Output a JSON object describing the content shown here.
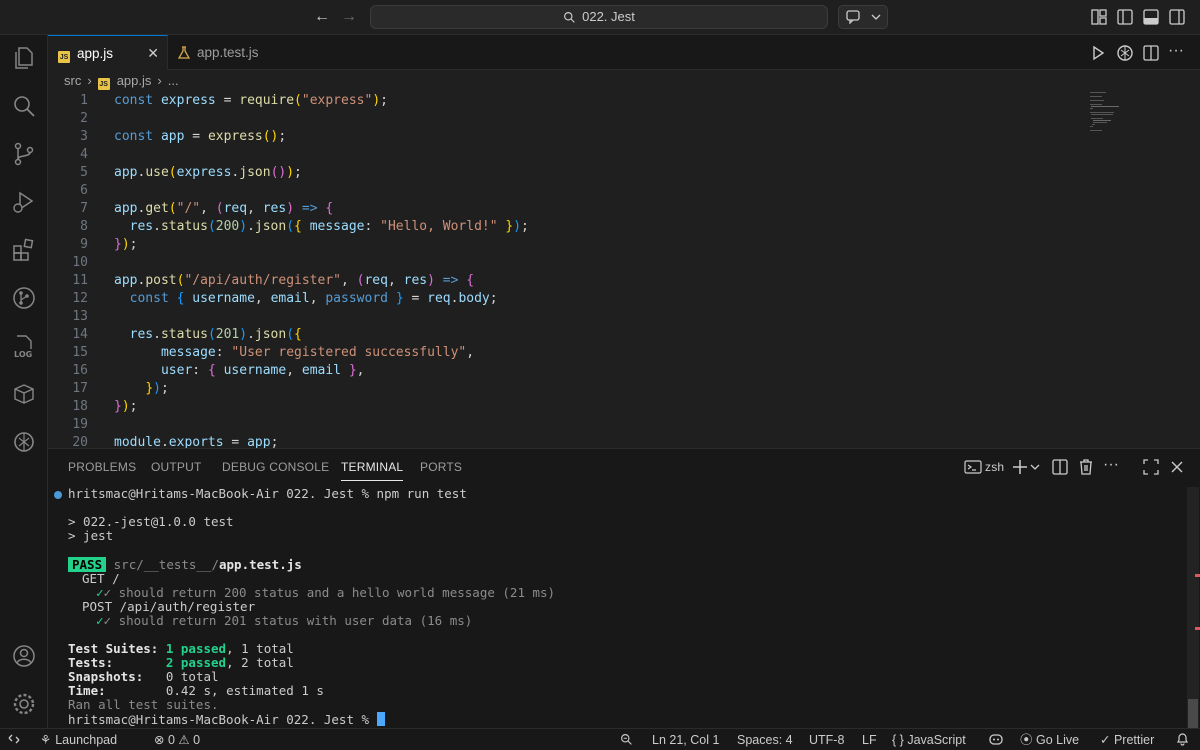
{
  "titlebar": {
    "back_icon": "arrow-left-icon",
    "forward_icon": "arrow-right-icon",
    "search_text": "022. Jest"
  },
  "tabs": [
    {
      "label": "app.js",
      "icon": "js-file-icon",
      "active": true
    },
    {
      "label": "app.test.js",
      "icon": "flask-icon",
      "active": false
    }
  ],
  "tabs_badge": "JS",
  "breadcrumb": {
    "folder": "src",
    "file": "app.js",
    "more": "..."
  },
  "editor": {
    "line_numbers": [
      "1",
      "2",
      "3",
      "4",
      "5",
      "6",
      "7",
      "8",
      "9",
      "10",
      "11",
      "12",
      "13",
      "14",
      "15",
      "16",
      "17",
      "18",
      "19",
      "20"
    ]
  },
  "panel": {
    "tabs": [
      "PROBLEMS",
      "OUTPUT",
      "DEBUG CONSOLE",
      "TERMINAL",
      "PORTS"
    ],
    "active_tab": "TERMINAL",
    "shell": "zsh"
  },
  "terminal": {
    "prompt": "hritsmac@Hritams-MacBook-Air 022. Jest % npm run test",
    "script_line": "> 022.-jest@1.0.0 test",
    "jest_line": "> jest",
    "pass_badge": "PASS",
    "suite_path": "src/__tests__/",
    "suite_file": "app.test.js",
    "group1": "GET /",
    "test1": "✓ should return 200 status and a hello world message (21 ms)",
    "group2": "POST /api/auth/register",
    "test2": "✓ should return 201 status with user data (16 ms)",
    "suites_label": "Test Suites:",
    "suites_passed": "1 passed",
    "suites_total": ", 1 total",
    "tests_label": "Tests:",
    "tests_passed": "2 passed",
    "tests_total": ", 2 total",
    "snapshots_label": "Snapshots:",
    "snapshots_value": "0 total",
    "time_label": "Time:",
    "time_value": "0.42 s, estimated 1 s",
    "ran_all": "Ran all test suites.",
    "final_prompt": "hritsmac@Hritams-MacBook-Air 022. Jest % "
  },
  "statusbar": {
    "launchpad": "Launchpad",
    "errors": "0",
    "warnings": "0",
    "position": "Ln 21, Col 1",
    "spaces": "Spaces: 4",
    "encoding": "UTF-8",
    "eol": "LF",
    "language": "JavaScript",
    "golive": "Go Live",
    "prettier": "Prettier"
  },
  "colors": {
    "accent": "#0078d4",
    "pass": "#23d18b",
    "background": "#1f1f1f"
  }
}
